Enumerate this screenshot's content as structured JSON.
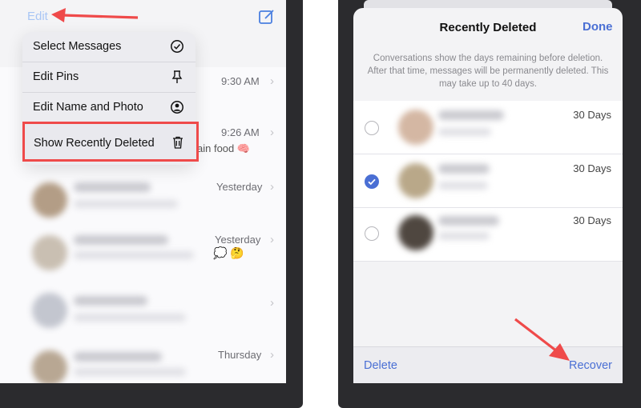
{
  "left": {
    "edit_label": "Edit",
    "menu": {
      "items": [
        {
          "label": "Select Messages",
          "icon": "checkmark-circle-icon"
        },
        {
          "label": "Edit Pins",
          "icon": "pin-icon"
        },
        {
          "label": "Edit Name and Photo",
          "icon": "person-circle-icon"
        },
        {
          "label": "Show Recently Deleted",
          "icon": "trash-icon"
        }
      ]
    },
    "conversations": [
      {
        "time": "9:30 AM",
        "preview": ""
      },
      {
        "time": "9:26 AM",
        "preview": "ain food 🧠"
      },
      {
        "time": "Yesterday",
        "preview": ""
      },
      {
        "time": "Yesterday",
        "preview": "💭 🤔"
      },
      {
        "time": "",
        "preview": ""
      },
      {
        "time": "Thursday",
        "preview": ""
      }
    ]
  },
  "right": {
    "title": "Recently Deleted",
    "done_label": "Done",
    "info": "Conversations show the days remaining before deletion. After that time, messages will be permanently deleted. This may take up to 40 days.",
    "items": [
      {
        "days": "30 Days",
        "selected": false
      },
      {
        "days": "30 Days",
        "selected": true
      },
      {
        "days": "30 Days",
        "selected": false
      }
    ],
    "delete_label": "Delete",
    "recover_label": "Recover"
  },
  "colors": {
    "accent_blue": "#4a6fd4",
    "highlight_red": "#ef4a4a"
  }
}
